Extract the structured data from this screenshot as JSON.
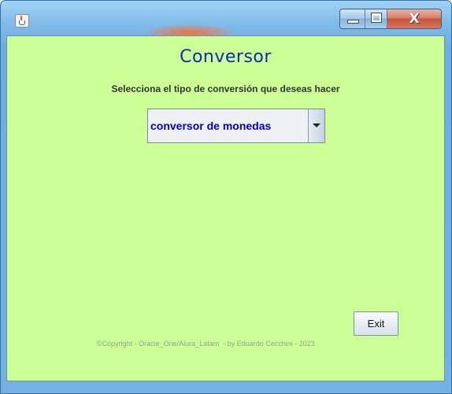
{
  "window": {
    "icon": "java-cup-icon",
    "buttons": {
      "minimize_icon": "minimize-icon",
      "maximize_icon": "maximize-icon",
      "close_label": "X"
    }
  },
  "main": {
    "title": "Conversor",
    "instruction": "Selecciona el tipo de conversión que deseas hacer",
    "conversion_select": {
      "selected": "conversor de monedas",
      "icon": "chevron-down-icon"
    },
    "exit_label": "Exit",
    "copyright": "©Copyright - Oracle_One/Alura_Latam  - by Eduardo Cecchini - 2023"
  },
  "colors": {
    "background": "#ccfe96",
    "title": "#0f2ab4",
    "selected_text": "#0000cc"
  }
}
